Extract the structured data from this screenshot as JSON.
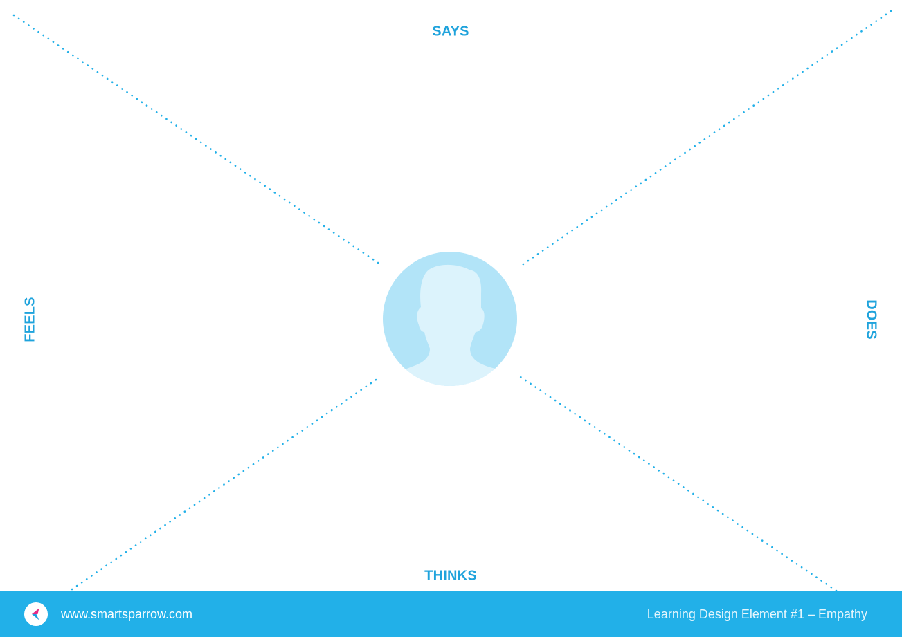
{
  "colors": {
    "accent": "#22b0e8",
    "label": "#1fa3dc",
    "avatar_bg": "#b2e4f8",
    "avatar_figure": "#dcf3fc",
    "footer_bg": "#22b0e8",
    "logo_magenta": "#e62a86",
    "logo_blue": "#1d9fe0"
  },
  "quadrants": {
    "says": "SAYS",
    "thinks": "THINKS",
    "feels": "FEELS",
    "does": "DOES"
  },
  "center": {
    "icon": "user-silhouette-icon"
  },
  "footer": {
    "logo_icon": "smart-sparrow-logo-icon",
    "url": "www.smartsparrow.com",
    "caption": "Learning Design Element #1 – Empathy"
  }
}
